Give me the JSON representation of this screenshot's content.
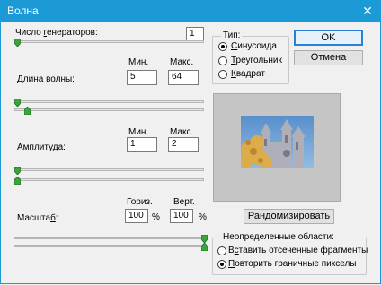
{
  "window": {
    "title": "Волна",
    "close_glyph": "✕"
  },
  "generators": {
    "label_pre": "Число ",
    "label_u": "г",
    "label_post": "енераторов:",
    "value": "1"
  },
  "type": {
    "legend": "Тип:",
    "options": [
      {
        "pre": "",
        "u": "С",
        "post": "инусоида",
        "selected": true
      },
      {
        "pre": "",
        "u": "Т",
        "post": "реугольник",
        "selected": false
      },
      {
        "pre": "",
        "u": "К",
        "post": "вадрат",
        "selected": false
      }
    ]
  },
  "buttons": {
    "ok": "OK",
    "cancel": "Отмена",
    "randomize": "Рандомизировать"
  },
  "wavelength": {
    "label_pre": "",
    "label_u": "Д",
    "label_post": "лина волны:",
    "min_label": "Мин.",
    "max_label": "Макс.",
    "min": "5",
    "max": "64"
  },
  "amplitude": {
    "label_pre": "",
    "label_u": "А",
    "label_post": "мплитуда:",
    "min_label": "Мин.",
    "max_label": "Макс.",
    "min": "1",
    "max": "2"
  },
  "scale": {
    "label_pre": "Масшта",
    "label_u": "б",
    "label_post": ":",
    "horiz_label": "Гориз.",
    "vert_label": "Верт.",
    "horiz": "100",
    "vert": "100",
    "unit": "%"
  },
  "undefined_areas": {
    "legend": "Неопределенные области:",
    "options": [
      {
        "pre": "В",
        "u": "с",
        "post": "тавить отсеченные фрагменты",
        "selected": false
      },
      {
        "pre": "",
        "u": "П",
        "post": "овторить граничные пикселы",
        "selected": true
      }
    ]
  },
  "colors": {
    "titlebar": "#1c9ad6",
    "accent": "#2b7fd6",
    "slider_thumb": "#3aa53a"
  },
  "icons": {
    "slider_thumb": "slider-thumb-icon",
    "close": "close-icon"
  }
}
